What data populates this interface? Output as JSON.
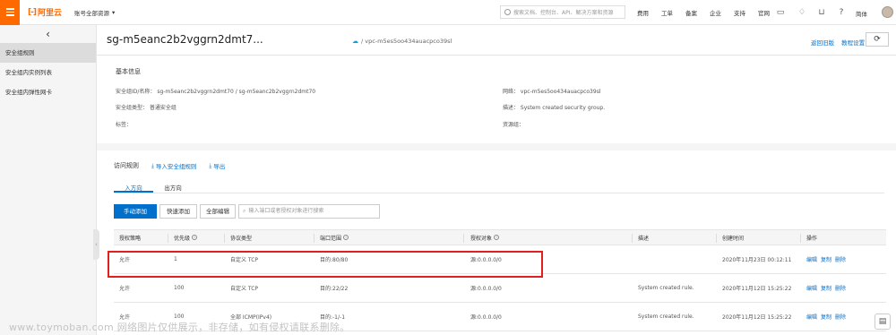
{
  "topbar": {
    "logo_text": "阿里云",
    "account_selector": "账号全部资源",
    "search_placeholder": "搜索文档、控制台、API、解决方案和资源",
    "nav": [
      "费用",
      "工单",
      "备案",
      "企业",
      "支持",
      "官网"
    ],
    "language": "简体"
  },
  "sidebar": {
    "items": [
      {
        "label": "安全组规则",
        "active": true
      },
      {
        "label": "安全组内实例列表",
        "active": false
      },
      {
        "label": "安全组内弹性网卡",
        "active": false
      }
    ]
  },
  "header": {
    "title": "sg-m5eanc2b2vggrn2dmt7...",
    "vpc": "/ vpc-m5es5oo434auacpco39sl",
    "links": [
      "返回旧版",
      "教程设置"
    ]
  },
  "basic_info": {
    "section_title": "基本信息",
    "fields": {
      "id_name": "安全组ID/名称：  sg-m5eanc2b2vggrn2dmt70 / sg-m5eanc2b2vggrn2dmt70",
      "type": "安全组类型：  普通安全组",
      "tags": "标签：",
      "network": "网络：  vpc-m5es5oo434auacpco39sl",
      "description": "描述：  System created security group.",
      "resource_group": "资源组："
    }
  },
  "rules": {
    "section_title": "访问规则",
    "import_label": "导入安全组规则",
    "export_label": "导出",
    "tabs": [
      {
        "label": "入方向",
        "active": true
      },
      {
        "label": "出方向",
        "active": false
      }
    ],
    "buttons": {
      "manual_add": "手动添加",
      "quick_add": "快速添加",
      "edit_all": "全部编辑"
    },
    "filter_placeholder": "输入端口或者授权对象进行搜索",
    "columns": [
      "授权策略",
      "优先级",
      "协议类型",
      "端口范围",
      "授权对象",
      "描述",
      "创建时间",
      "操作"
    ],
    "rows": [
      {
        "policy": "允许",
        "priority": "1",
        "protocol": "自定义 TCP",
        "port": "目的:80/80",
        "source": "源:0.0.0.0/0",
        "description": "",
        "created": "2020年11月23日 00:12:11",
        "ops": [
          "编辑",
          "复制",
          "删除"
        ]
      },
      {
        "policy": "允许",
        "priority": "100",
        "protocol": "自定义 TCP",
        "port": "目的:22/22",
        "source": "源:0.0.0.0/0",
        "description": "System created rule.",
        "created": "2020年11月12日 15:25:22",
        "ops": [
          "编辑",
          "复制",
          "删除"
        ]
      },
      {
        "policy": "允许",
        "priority": "100",
        "protocol": "全部 ICMP(IPv4)",
        "port": "目的:-1/-1",
        "source": "源:0.0.0.0/0",
        "description": "System created rule.",
        "created": "2020年11月12日 15:25:22",
        "ops": [
          "编辑",
          "复制",
          "删除"
        ]
      }
    ]
  },
  "watermark": "www.toymoban.com 网络图片仅供展示，非存储，如有侵权请联系删除。",
  "colors": {
    "brand": "#ff6a00",
    "link": "#0070cc",
    "highlight": "#e02020"
  }
}
